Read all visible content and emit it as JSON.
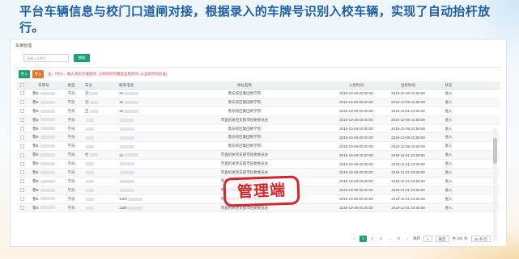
{
  "headline": "平台车辆信息与校门口道闸对接，根据录入的车牌号识别入校车辆，实现了自动抬杆放行。",
  "panel": {
    "title": "车辆管理",
    "search_placeholder": "请输入车牌号",
    "search_button": "搜索",
    "btn_a": "导入",
    "btn_b": "导入",
    "note": "注：(导入、搬入状态只能操作, 入校时间为最后出校时间, 以当前时间为准)"
  },
  "columns": [
    "",
    "车牌号",
    "类型",
    "车主",
    "联系电话",
    "地址名称",
    "入校时间",
    "出校时间",
    "状态"
  ],
  "rows": [
    {
      "plate": "鲁B·",
      "type": "学员",
      "owner": "刘",
      "phone": "18",
      "addr": "鲁东校区集团继学院",
      "in": "2019-10-28 00:00:00",
      "out": "2019-12-08 23:59:59",
      "status": "进入"
    },
    {
      "plate": "鲁B·",
      "type": "学员",
      "owner": "刘",
      "phone": "16",
      "addr": "鲁东校区集团继学院",
      "in": "2019-10-28 00:00:00",
      "out": "2019-12-08 23:59:59",
      "status": "进入"
    },
    {
      "plate": "鲁B·",
      "type": "学员",
      "owner": "王",
      "phone": "18",
      "addr": "鲁东校区集团继学院",
      "in": "2019-10-28 00:00:00",
      "out": "2019-11-01 23:59:59",
      "status": "进入"
    },
    {
      "plate": "鲁B·",
      "type": "学员",
      "owner": "",
      "phone": "",
      "addr": "市直机关党支部市纪委委员办",
      "in": "2019-10-28 00:00:00",
      "out": "2019-12-08 23:59:59",
      "status": "进入"
    },
    {
      "plate": "鲁B·",
      "type": "学员",
      "owner": "",
      "phone": "",
      "addr": "鲁东校区集团继学院",
      "in": "2019-10-28 00:00:00",
      "out": "2019-12-08 23:59:59",
      "status": "进入"
    },
    {
      "plate": "鲁B·",
      "type": "学员",
      "owner": "",
      "phone": "",
      "addr": "鲁东校区集团继学院",
      "in": "2019-10-28 00:00:00",
      "out": "2019-12-08 23:59:59",
      "status": "进入"
    },
    {
      "plate": "鲁B·",
      "type": "学员",
      "owner": "",
      "phone": "",
      "addr": "鲁东校区集团继学院",
      "in": "2019-10-28 00:00:00",
      "out": "2019-12-08 23:59:59",
      "status": "进入"
    },
    {
      "plate": "鲁B·",
      "type": "学员",
      "owner": "杜",
      "phone": "13",
      "addr": "市直机关党支部市纪委委员办",
      "in": "2019-10-28 00:00:00",
      "out": "2019-11-01 23:59:59",
      "status": "进入"
    },
    {
      "plate": "鲁B·",
      "type": "学员",
      "owner": "",
      "phone": "",
      "addr": "市直机关党支部市纪委委员办",
      "in": "2019-10-28 00:00:00",
      "out": "2019-11-01 23:59:59",
      "status": "进入"
    },
    {
      "plate": "鲁B·",
      "type": "学员",
      "owner": "",
      "phone": "",
      "addr": "市直机关党支部市纪委委员办",
      "in": "2019-10-28 00:00:00",
      "out": "2019-11-01 23:59:59",
      "status": "进入"
    },
    {
      "plate": "鲁B·",
      "type": "学员",
      "owner": "",
      "phone": "",
      "addr": "市直机关党支部市纪委委员办",
      "in": "2019-10-28 00:00:00",
      "out": "2019-11-01 23:59:59",
      "status": "进入"
    },
    {
      "plate": "鲁B·",
      "type": "学员",
      "owner": "",
      "phone": "",
      "addr": "市直机关党支部市纪委委员办",
      "in": "2019-10-28 00:00:00",
      "out": "2019-11-01 23:59:59",
      "status": "进入"
    },
    {
      "plate": "鲁B·",
      "type": "学员",
      "owner": "",
      "phone": "1380",
      "addr": "市直机关党支部市纪委委员办",
      "in": "2019-10-28 00:00:00",
      "out": "2019-11-01 23:59:59",
      "status": "进入"
    },
    {
      "plate": "鲁B·",
      "type": "学员",
      "owner": "",
      "phone": "1380",
      "addr": "市直机关党支部市纪委委员办",
      "in": "2019-10-28 00:00:00",
      "out": "2019-11-01 23:59:59",
      "status": "进入"
    }
  ],
  "pager": {
    "prev": "‹",
    "pages": [
      "1",
      "2",
      "3",
      "...",
      "9"
    ],
    "next": "›",
    "goto_label": "跳转",
    "page_input": "1",
    "confirm": "确定",
    "total": "共 401 条",
    "per_page": "20 条/页"
  },
  "stamp": "管理端"
}
